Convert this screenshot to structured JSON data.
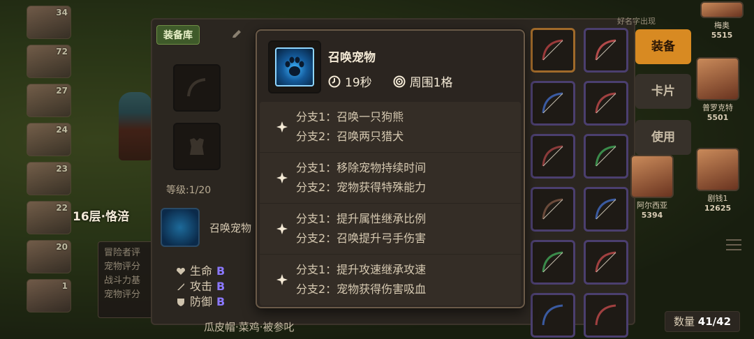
{
  "hero_list": {
    "levels": [
      "34",
      "72",
      "27",
      "24",
      "23",
      "22",
      "20",
      "1"
    ]
  },
  "scene": {
    "floor_label": "16层·恪涪"
  },
  "left_tooltip": {
    "lines": [
      "冒险者评",
      "宠物评分",
      "战斗力基",
      "宠物评分"
    ]
  },
  "equip_panel": {
    "tag": "装备库",
    "level_text": "等级:1/20",
    "skill_name": "召唤宠物",
    "stats": [
      {
        "label": "生命",
        "grade": "B"
      },
      {
        "label": "攻击",
        "grade": "B"
      },
      {
        "label": "防御",
        "grade": "B"
      }
    ],
    "footer_text": "瓜皮帽·菜鸡·被参叱",
    "count_label": "数量",
    "count_value": "41/42"
  },
  "tabs": {
    "equip": "装备",
    "card": "卡片",
    "use": "使用"
  },
  "roster": [
    {
      "name": "梅奥",
      "value": "5515"
    },
    {
      "name": "普罗克特",
      "value": "5501"
    },
    {
      "name": "阿尔西亚",
      "value": "5394"
    },
    {
      "name": "剧钱1",
      "value": "12625"
    }
  ],
  "roster_top_text": "好名字出现",
  "skill_tooltip": {
    "title": "召唤宠物",
    "duration": "19秒",
    "range": "周围1格",
    "icon": "paw-icon",
    "branches": [
      {
        "b1": "分支1：召唤一只狗熊",
        "b2": "分支2：召唤两只猎犬"
      },
      {
        "b1": "分支1：移除宠物持续时间",
        "b2": "分支2：宠物获得特殊能力"
      },
      {
        "b1": "分支1：提升属性继承比例",
        "b2": "分支2：召唤提升弓手伤害"
      },
      {
        "b1": "分支1：提升攻速继承攻速",
        "b2": "分支2：宠物获得伤害吸血"
      }
    ]
  },
  "colors": {
    "accent": "#d88a22",
    "grade": "#8b78ff",
    "rare_border": "#4b3f6f",
    "legend_border": "#a06a2a"
  }
}
